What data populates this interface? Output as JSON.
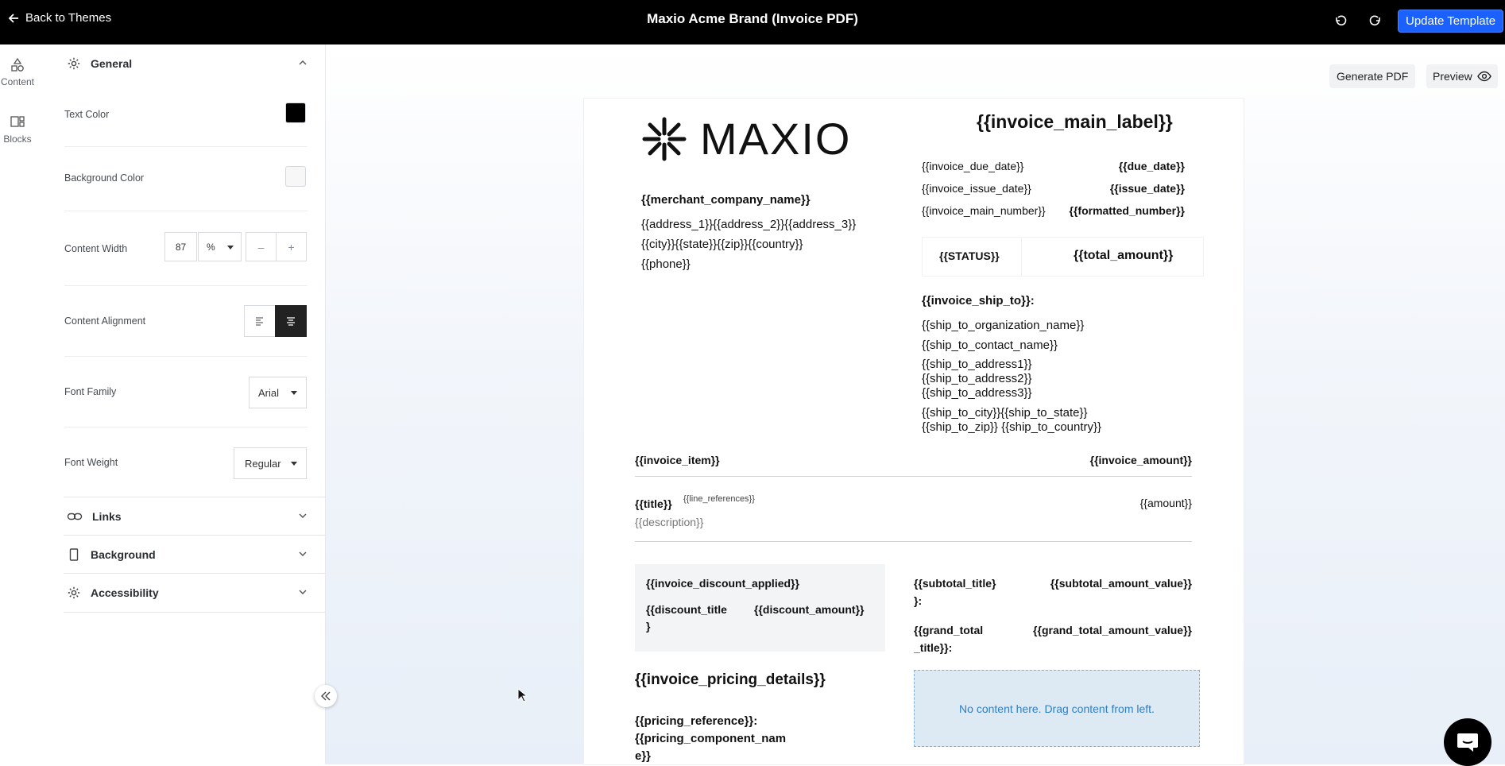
{
  "topbar": {
    "back_label": "Back to Themes",
    "title": "Maxio Acme Brand (Invoice PDF)",
    "update_label": "Update Template"
  },
  "rail": {
    "content_label": "Content",
    "blocks_label": "Blocks"
  },
  "panel": {
    "general": {
      "label": "General",
      "text_color_label": "Text Color",
      "text_color": "#000000",
      "bg_color_label": "Background Color",
      "bg_color": "#f7f7f8",
      "content_width_label": "Content Width",
      "content_width_value": "87",
      "content_width_unit": "%",
      "minus": "–",
      "plus": "+",
      "alignment_label": "Content Alignment",
      "font_family_label": "Font Family",
      "font_family_value": "Arial",
      "font_weight_label": "Font Weight",
      "font_weight_value": "Regular"
    },
    "links_label": "Links",
    "background_label": "Background",
    "accessibility_label": "Accessibility"
  },
  "canvas": {
    "generate_pdf_label": "Generate PDF",
    "preview_label": "Preview"
  },
  "doc": {
    "logo_text": "MAXIO",
    "invoice_main_label": "{{invoice_main_label}}",
    "merchant_company_name": "{{merchant_company_name}}",
    "address_line1": "{{address_1}}{{address_2}}{{address_3}}",
    "address_line2": "{{city}}{{state}}{{zip}}{{country}}",
    "phone": "{{phone}}",
    "meta": [
      {
        "label": "{{invoice_due_date}}",
        "value": "{{due_date}}"
      },
      {
        "label": "{{invoice_issue_date}}",
        "value": "{{issue_date}}"
      },
      {
        "label": "{{invoice_main_number}}",
        "value": "{{formatted_number}}"
      }
    ],
    "status": "{{STATUS}}",
    "total_amount": "{{total_amount}}",
    "ship_to_heading": "{{invoice_ship_to}}:",
    "ship_to_lines": [
      "{{ship_to_organization_name}}",
      "{{ship_to_contact_name}}",
      "{{ship_to_address1}}",
      "{{ship_to_address2}}",
      "{{ship_to_address3}}",
      "{{ship_to_city}}{{ship_to_state}}",
      "{{ship_to_zip}} {{ship_to_country}}"
    ],
    "item_header": "{{invoice_item}}",
    "amount_header": "{{invoice_amount}}",
    "line_title": "{{title}}",
    "line_references": "{{line_references}}",
    "line_description": "{{description}}",
    "line_amount": "{{amount}}",
    "discount_applied": "{{invoice_discount_applied}}",
    "discount_title_a": "{{discount_title",
    "discount_title_b": "}",
    "discount_amount": "{{discount_amount}}",
    "subtotal_title_a": "{{subtotal_title}",
    "subtotal_title_b": "}:",
    "subtotal_value": "{{subtotal_amount_value}}",
    "grand_total_title_a": "{{grand_total",
    "grand_total_title_b": "_title}}:",
    "grand_total_value": "{{grand_total_amount_value}}",
    "pricing_details": "{{invoice_pricing_details}}",
    "pricing_reference": "{{pricing_reference}}:",
    "pricing_component_a": "{{pricing_component_nam",
    "pricing_component_b": "e}}",
    "drop_zone_text": "No content here. Drag content from left."
  }
}
